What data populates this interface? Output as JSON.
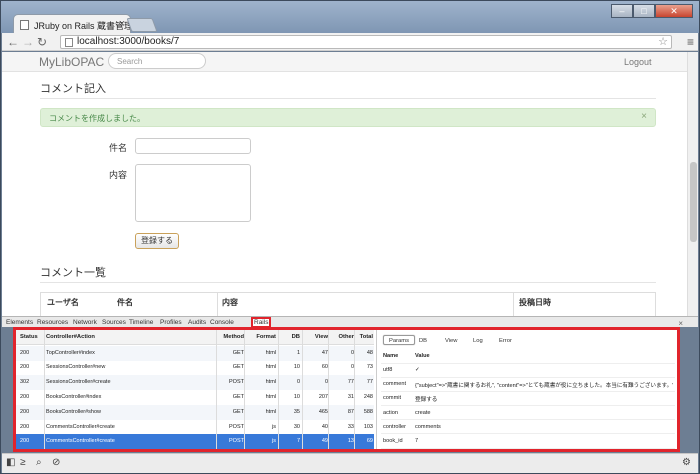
{
  "browser": {
    "tab_title": "JRuby on Rails 蔵書管理",
    "url": "localhost:3000/books/7",
    "window_buttons": [
      "–",
      "□",
      "✕"
    ]
  },
  "site": {
    "brand": "MyLibOPAC",
    "search_placeholder": "Search",
    "logout": "Logout"
  },
  "comment_form": {
    "heading": "コメント記入",
    "alert": "コメントを作成しました。",
    "alert_close": "×",
    "subject_label": "件名",
    "body_label": "内容",
    "submit": "登録する"
  },
  "comment_list": {
    "heading": "コメント一覧",
    "columns": [
      "ユーザ名",
      "件名",
      "内容",
      "投稿日時"
    ]
  },
  "devtools": {
    "tabs": [
      "Elements",
      "Resources",
      "Network",
      "Sources",
      "Timeline",
      "Profiles",
      "Audits",
      "Console",
      "Rails"
    ],
    "close": "×",
    "request_columns": [
      "Status",
      "Controller#Action",
      "Method",
      "Format",
      "DB",
      "View",
      "Other",
      "Total"
    ],
    "requests": [
      [
        "200",
        "TopController#index",
        "GET",
        "html",
        "1",
        "47",
        "0",
        "48"
      ],
      [
        "200",
        "SessionsController#new",
        "GET",
        "html",
        "10",
        "60",
        "0",
        "73"
      ],
      [
        "302",
        "SessionsController#create",
        "POST",
        "html",
        "0",
        "0",
        "77",
        "77"
      ],
      [
        "200",
        "BooksController#index",
        "GET",
        "html",
        "10",
        "207",
        "31",
        "248"
      ],
      [
        "200",
        "BooksController#show",
        "GET",
        "html",
        "35",
        "465",
        "87",
        "588"
      ],
      [
        "200",
        "CommentsController#create",
        "POST",
        "js",
        "30",
        "40",
        "33",
        "103"
      ],
      [
        "200",
        "CommentsController#create",
        "POST",
        "js",
        "7",
        "49",
        "13",
        "69"
      ]
    ],
    "selected_request": 6,
    "param_tabs": [
      "Params",
      "DB",
      "View",
      "Log",
      "Error"
    ],
    "param_columns": [
      "Name",
      "Value"
    ],
    "params": [
      [
        "utf8",
        "✓"
      ],
      [
        "comment",
        "{\"subject\"=>\"蔵書に関するお礼\", \"content\"=>\"とても蔵書が役に立ちました。本当に有難うございます。\"}"
      ],
      [
        "commit",
        "登録する"
      ],
      [
        "action",
        "create"
      ],
      [
        "controller",
        "comments"
      ],
      [
        "book_id",
        "7"
      ]
    ]
  },
  "colors": {
    "highlight_border": "#e1242c",
    "selected_row": "#3879d9",
    "alert_bg": "#dff0d8"
  },
  "icons": {
    "statusbar": [
      "dock-icon",
      "console-icon",
      "search-icon",
      "no-entry-icon",
      "gear-icon"
    ]
  }
}
